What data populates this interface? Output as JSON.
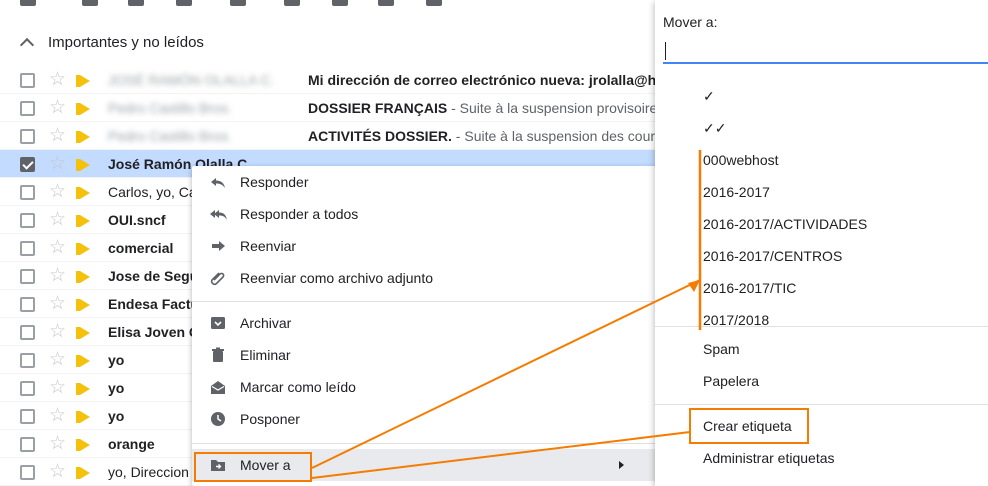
{
  "section": {
    "title": "Importantes y no leídos"
  },
  "emails": [
    {
      "sender": "JOSÉ RAMÓN OLALLA C.",
      "sender_blurred": true,
      "sender_bold": false,
      "subject": "Mi dirección de correo electrónico nueva: jrolalla@hot",
      "snippet": "",
      "selected": false
    },
    {
      "sender": "Pedro Castillo Bros.",
      "sender_blurred": true,
      "sender_bold": false,
      "subject": "DOSSIER FRANÇAIS",
      "snippet": " - Suite à la suspension provisoire",
      "selected": false
    },
    {
      "sender": "Pedro Castillo Bros.",
      "sender_blurred": true,
      "sender_bold": false,
      "subject": "ACTIVITÉS DOSSIER.",
      "snippet": " - Suite à la suspension des cours",
      "selected": false
    },
    {
      "sender": "José Ramón Olalla C.",
      "sender_blurred": false,
      "sender_bold": true,
      "subject": "",
      "snippet": "",
      "selected": true
    },
    {
      "sender": "Carlos, yo, Ca",
      "sender_blurred": false,
      "sender_bold": false,
      "subject": "",
      "snippet": "",
      "selected": false
    },
    {
      "sender": "OUI.sncf",
      "sender_blurred": false,
      "sender_bold": true,
      "subject": "",
      "snippet": "",
      "selected": false
    },
    {
      "sender": "comercial",
      "sender_blurred": false,
      "sender_bold": true,
      "subject": "",
      "snippet": "",
      "selected": false
    },
    {
      "sender": "Jose de Segu",
      "sender_blurred": false,
      "sender_bold": true,
      "subject": "",
      "snippet": "",
      "selected": false
    },
    {
      "sender": "Endesa Factu",
      "sender_blurred": false,
      "sender_bold": true,
      "subject": "",
      "snippet": "",
      "selected": false
    },
    {
      "sender": "Elisa Joven G",
      "sender_blurred": false,
      "sender_bold": true,
      "subject": "",
      "snippet": "",
      "selected": false
    },
    {
      "sender": "yo",
      "sender_blurred": false,
      "sender_bold": true,
      "subject": "",
      "snippet": "",
      "selected": false
    },
    {
      "sender": "yo",
      "sender_blurred": false,
      "sender_bold": true,
      "subject": "",
      "snippet": "",
      "selected": false
    },
    {
      "sender": "yo",
      "sender_blurred": false,
      "sender_bold": true,
      "subject": "",
      "snippet": "",
      "selected": false
    },
    {
      "sender": "orange",
      "sender_blurred": false,
      "sender_bold": true,
      "subject": "",
      "snippet": "",
      "selected": false
    },
    {
      "sender": "yo, Direccion",
      "sender_blurred": false,
      "sender_bold": false,
      "subject": "",
      "snippet": "",
      "selected": false
    }
  ],
  "context_menu": {
    "items": [
      {
        "label": "Responder",
        "icon": "reply-icon"
      },
      {
        "label": "Responder a todos",
        "icon": "reply-all-icon"
      },
      {
        "label": "Reenviar",
        "icon": "forward-icon"
      },
      {
        "label": "Reenviar como archivo adjunto",
        "icon": "attachment-icon"
      },
      {
        "label": "Archivar",
        "icon": "archive-icon"
      },
      {
        "label": "Eliminar",
        "icon": "trash-icon"
      },
      {
        "label": "Marcar como leído",
        "icon": "envelope-open-icon"
      },
      {
        "label": "Posponer",
        "icon": "clock-icon"
      },
      {
        "label": "Mover a",
        "icon": "move-to-folder-icon"
      }
    ]
  },
  "move_panel": {
    "title": "Mover a:",
    "input_value": "",
    "labels": [
      "✓",
      "✓✓",
      "000webhost",
      "2016-2017",
      "2016-2017/ACTIVIDADES",
      "2016-2017/CENTROS",
      "2016-2017/TIC",
      "2017/2018"
    ],
    "system": [
      "Spam",
      "Papelera"
    ],
    "actions": [
      "Crear etiqueta",
      "Administrar etiquetas"
    ]
  },
  "colors": {
    "accent": "#4285f4",
    "annotation": "#f57c00",
    "selected_row": "#c2dbff",
    "important": "#f4c20d"
  }
}
